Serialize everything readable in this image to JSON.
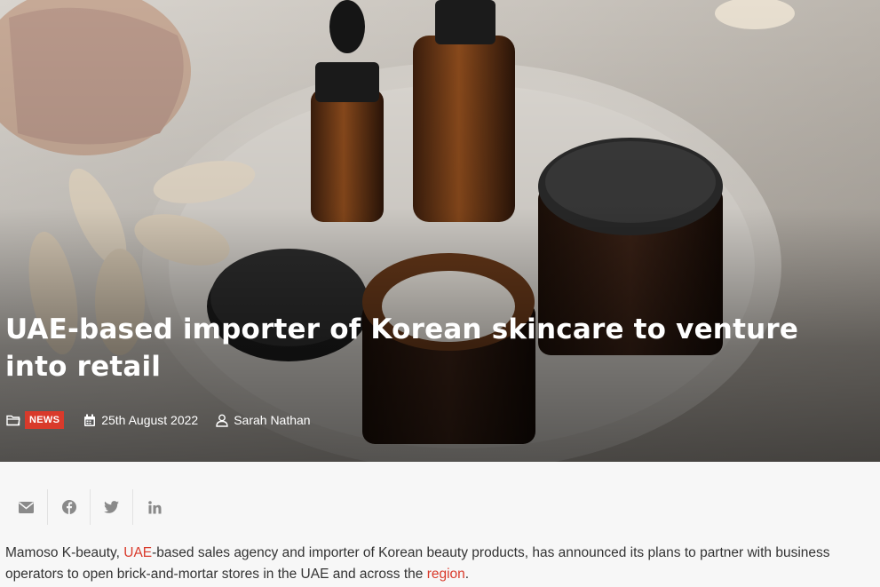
{
  "article": {
    "title": "UAE-based importer of Korean skincare to venture into retail",
    "category": "NEWS",
    "date": "25th August 2022",
    "author": "Sarah Nathan",
    "paragraph": {
      "part1": "Mamoso K-beauty, ",
      "link1": "UAE",
      "part2": "-based sales agency and importer of Korean beauty products, has announced its plans to partner with business operators to open brick-and-mortar stores in the UAE and across the ",
      "link2": "region",
      "part3": "."
    }
  },
  "icons": {
    "category": "folder-icon",
    "date": "calendar-icon",
    "author": "user-icon",
    "share": [
      "email-icon",
      "facebook-icon",
      "twitter-icon",
      "linkedin-icon"
    ]
  },
  "colors": {
    "accent": "#d93a2b",
    "share_icon": "#888888"
  }
}
